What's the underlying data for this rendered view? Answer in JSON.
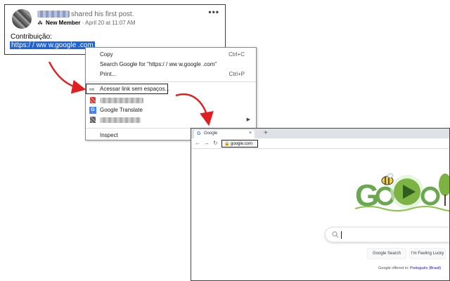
{
  "post": {
    "action_text": "shared his first post.",
    "badge_label": "New Member",
    "timestamp": "April 20 at 11:07 AM",
    "body_text": "Contribuição:",
    "link_text": "https:/ / ww w.google .com",
    "more_icon": "more-dots-icon"
  },
  "context_menu": {
    "items": [
      {
        "label": "Copy",
        "shortcut": "Ctrl+C"
      },
      {
        "label": "Search Google for \"https:/ / ww w.google .com\"",
        "shortcut": ""
      },
      {
        "label": "Print...",
        "shortcut": "Ctrl+P"
      },
      {
        "label": "Acessar link sem espaços...",
        "shortcut": ""
      },
      {
        "label": "Google Translate",
        "shortcut": ""
      },
      {
        "label": "Inspect",
        "shortcut": ""
      }
    ],
    "submenu_arrow": "▶"
  },
  "browser": {
    "tab_title": "Google",
    "tab_close": "×",
    "new_tab": "+",
    "url": "google.com",
    "nav": {
      "back": "←",
      "forward": "→",
      "reload": "↻"
    }
  },
  "google": {
    "search_button": "Google Search",
    "lucky_button": "I'm Feeling Lucky",
    "offered_text": "Google offered in:",
    "language_link": "Português (Brasil)"
  },
  "colors": {
    "highlight": "#1f64d8",
    "arrow": "#e02020",
    "google_blue": "#4285f4"
  }
}
